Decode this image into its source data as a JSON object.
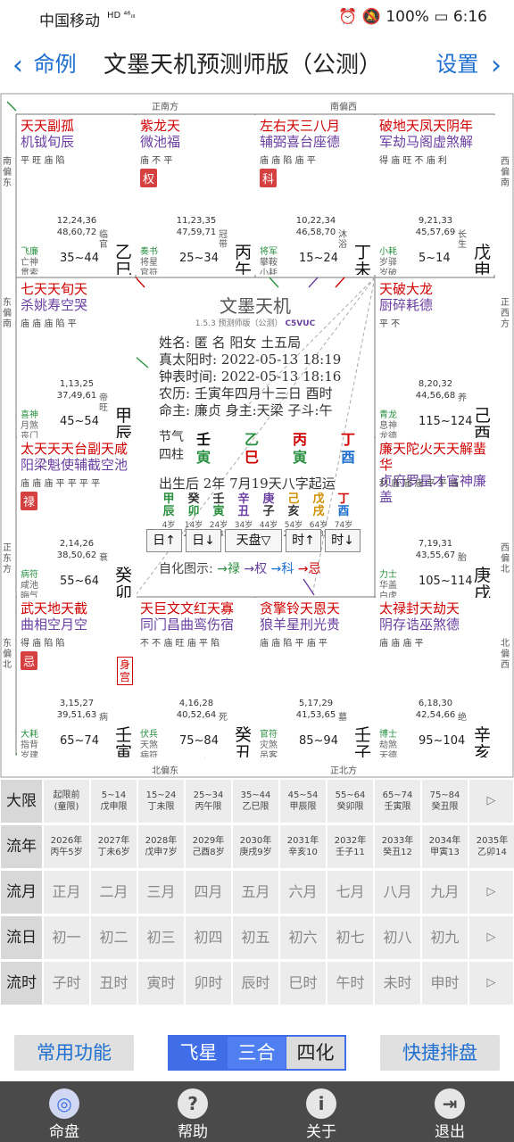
{
  "status": {
    "carrier": "中国移动",
    "network": "HD ⁴⁶ᵢₗₗ",
    "battery": "100%",
    "time": "6:16"
  },
  "nav": {
    "back": "命例",
    "title": "文墨天机预测师版（公测）",
    "settings": "设置"
  },
  "directions": {
    "top_left": "正南方",
    "top_right": "南偏西",
    "bottom_left": "北偏东",
    "bottom_right": "正北方",
    "left_1": "南偏东",
    "left_2": "东偏南",
    "left_3": "正东方",
    "left_4": "东偏北",
    "right_1": "西偏南",
    "right_2": "正西方",
    "right_3": "西偏北",
    "right_4": "北偏西"
  },
  "palaces": [
    {
      "stars_top": "天天副孤",
      "stars_top2": "机钺旬辰",
      "bright": "平 旺 庙 陷",
      "sihua": "",
      "ages1": "12,24,36",
      "ages2": "48,60,72",
      "dx": "35~44",
      "zs": "临官",
      "gz": "乙巳",
      "name": "子女",
      "god1": "飞廉",
      "god2": "亡神",
      "god3": "贯索"
    },
    {
      "stars_top": "紫龙天",
      "stars_top2": "微池福",
      "bright": "庙 不 平",
      "sihua": "权",
      "ages1": "11,23,35",
      "ages2": "47,59,71",
      "dx": "25~34",
      "zs": "冠带",
      "gz": "丙午",
      "name": "夫妻",
      "god1": "奏书",
      "god2": "将星",
      "god3": "官符"
    },
    {
      "stars_top": "左右天三八月",
      "stars_top2": "辅弼喜台座德",
      "bright": "庙 庙 陷 庙 平",
      "sihua": "科",
      "ages1": "10,22,34",
      "ages2": "46,58,70",
      "dx": "15~24",
      "zs": "沐浴",
      "gz": "丁未",
      "name": "兄弟",
      "god1": "将军",
      "god2": "攀鞍",
      "god3": "小耗"
    },
    {
      "stars_top": "破地天凤天阴年",
      "stars_top2": "军劫马阁虚煞解",
      "bright": "得 庙 旺 不 庙 利",
      "sihua": "",
      "ages1": "9,21,33",
      "ages2": "45,57,69",
      "dx": "5~14",
      "zs": "长生",
      "gz": "戊申",
      "name": "命宫",
      "god1": "小耗",
      "god2": "岁驿",
      "god3": "岁破"
    },
    {
      "stars_top": "七天天旬天",
      "stars_top2": "杀姚寿空哭",
      "bright": "庙 庙 庙 陷 平",
      "sihua": "",
      "ages1": "1,13,25",
      "ages2": "37,49,61",
      "dx": "45~54",
      "zs": "帝旺",
      "gz": "甲辰",
      "name": "财帛",
      "god1": "喜神",
      "god2": "月煞",
      "god3": "丧门"
    },
    {
      "stars_top": "天破大龙",
      "stars_top2": "厨碎耗德",
      "bright": "平 不",
      "sihua": "",
      "ages1": "8,20,32",
      "ages2": "44,56,68",
      "dx": "115~124",
      "zs": "养",
      "gz": "己酉",
      "name": "父母",
      "god1": "青龙",
      "god2": "息神",
      "god3": "龙德"
    },
    {
      "stars_top": "太天天天台副天咸",
      "stars_top2": "阳梁魁使辅截空池",
      "bright": "庙 庙 庙 平   平 平 平",
      "sihua": "禄",
      "ages1": "2,14,26",
      "ages2": "38,50,62",
      "dx": "55~64",
      "zs": "衰",
      "gz": "癸卯",
      "name": "疾厄",
      "god1": "病符",
      "god2": "咸池",
      "god3": "晦气"
    },
    {
      "stars_top": "廉天陀火天天解蜚华",
      "stars_top2": "贞府罗星才官神廉盖",
      "bright": "利 庙 庙 庙 平 平   庙",
      "sihua": "",
      "ages1": "7,19,31",
      "ages2": "43,55,67",
      "dx": "105~114",
      "zs": "胎",
      "gz": "庚戌",
      "name": "福德",
      "god1": "力士",
      "god2": "华盖",
      "god3": "白虎"
    },
    {
      "stars_top": "武天地天截",
      "stars_top2": "曲相空月空",
      "bright": "得 庙 陷 陷",
      "sihua": "忌",
      "ages1": "3,15,27",
      "ages2": "39,51,63",
      "dx": "65~74",
      "zs": "病",
      "gz": "壬寅",
      "name": "迁移",
      "god1": "大耗",
      "god2": "指背",
      "god3": "岁建",
      "shen": "身宫"
    },
    {
      "stars_top": "天巨文文红天寡",
      "stars_top2": "同门昌曲鸾伤宿",
      "bright": "不 不 庙 旺 庙 平 陷",
      "sihua": "",
      "ages1": "4,16,28",
      "ages2": "40,52,64",
      "dx": "75~84",
      "zs": "死",
      "gz": "癸丑",
      "name": "交友",
      "god1": "伏兵",
      "god2": "天煞",
      "god3": "病符"
    },
    {
      "stars_top": "贪擎铃天恩天",
      "stars_top2": "狼羊星刑光贵",
      "bright": "庙 庙 陷 平 庙 平",
      "sihua": "",
      "ages1": "5,17,29",
      "ages2": "41,53,65",
      "dx": "85~94",
      "zs": "墓",
      "gz": "壬子",
      "name": "官禄",
      "god1": "官符",
      "god2": "灾煞",
      "god3": "吊客"
    },
    {
      "stars_top": "太禄封天劫天",
      "stars_top2": "阴存诰巫煞德",
      "bright": "庙 庙 庙 平",
      "sihua": "",
      "ages1": "6,18,30",
      "ages2": "42,54,66",
      "dx": "95~104",
      "zs": "绝",
      "gz": "辛亥",
      "name": "田宅",
      "god1": "博士",
      "god2": "劫煞",
      "god3": "天德"
    }
  ],
  "center": {
    "title": "文墨天机",
    "version": "1.5.3 预测师版（公测）",
    "code": "C5VUC",
    "name_line": "姓名: 匿 名      阳女 土五局",
    "solar_line": "真太阳时: 2022-05-13 18:19",
    "clock_line": "钟表时间: 2022-05-13 18:16",
    "lunar_line": "农历: 壬寅年四月十三日 酉时",
    "master_line": "命主: 廉贞 身主:天梁 子斗:午",
    "jieqi_label": "节气",
    "sizhu_label": "四柱",
    "jq": [
      "壬",
      "乙",
      "丙",
      "丁"
    ],
    "sz": [
      "寅",
      "巳",
      "寅",
      "酉"
    ],
    "trun_line": "出生后 2年 7月19天八字起运",
    "dayun": [
      {
        "g": "甲",
        "z": "辰",
        "a": "4岁",
        "y": "2025"
      },
      {
        "g": "癸",
        "z": "卯",
        "a": "14岁",
        "y": "2035"
      },
      {
        "g": "壬",
        "z": "寅",
        "a": "24岁",
        "y": "2045"
      },
      {
        "g": "辛",
        "z": "丑",
        "a": "34岁",
        "y": "2055"
      },
      {
        "g": "庚",
        "z": "子",
        "a": "44岁",
        "y": "2065"
      },
      {
        "g": "己",
        "z": "亥",
        "a": "54岁",
        "y": "2075"
      },
      {
        "g": "戊",
        "z": "戌",
        "a": "64岁",
        "y": "2085"
      },
      {
        "g": "丁",
        "z": "酉",
        "a": "74岁",
        "y": "2095"
      }
    ],
    "btn_day_up": "日↑",
    "btn_day_down": "日↓",
    "btn_pan": "天盘▽",
    "btn_hour_up": "时↑",
    "btn_hour_down": "时↓",
    "zihua_label": "自化图示:",
    "zihua_lu": "→禄",
    "zihua_quan": "→权",
    "zihua_ke": "→科",
    "zihua_ji": "→忌"
  },
  "rows": {
    "daxian": {
      "label": "大限",
      "cells": [
        [
          "起限前",
          "(童限)"
        ],
        [
          "5~14",
          "戊申限"
        ],
        [
          "15~24",
          "丁未限"
        ],
        [
          "25~34",
          "丙午限"
        ],
        [
          "35~44",
          "乙巳限"
        ],
        [
          "45~54",
          "甲辰限"
        ],
        [
          "55~64",
          "癸卯限"
        ],
        [
          "65~74",
          "壬寅限"
        ],
        [
          "75~84",
          "癸丑限"
        ]
      ],
      "arrow": "▷"
    },
    "liunian": {
      "label": "流年",
      "cells": [
        [
          "2026年",
          "丙午5岁"
        ],
        [
          "2027年",
          "丁未6岁"
        ],
        [
          "2028年",
          "戊申7岁"
        ],
        [
          "2029年",
          "己酉8岁"
        ],
        [
          "2030年",
          "庚戌9岁"
        ],
        [
          "2031年",
          "辛亥10"
        ],
        [
          "2032年",
          "壬子11"
        ],
        [
          "2033年",
          "癸丑12"
        ],
        [
          "2034年",
          "甲寅13"
        ],
        [
          "2035年",
          "乙卯14"
        ]
      ]
    },
    "liuyue": {
      "label": "流月",
      "cells": [
        "正月",
        "二月",
        "三月",
        "四月",
        "五月",
        "六月",
        "七月",
        "八月",
        "九月"
      ],
      "arrow": "▷"
    },
    "liuri": {
      "label": "流日",
      "cells": [
        "初一",
        "初二",
        "初三",
        "初四",
        "初五",
        "初六",
        "初七",
        "初八",
        "初九"
      ],
      "arrow": "▷"
    },
    "liushi": {
      "label": "流时",
      "cells": [
        "子时",
        "丑时",
        "寅时",
        "卯时",
        "辰时",
        "巳时",
        "午时",
        "未时",
        "申时"
      ],
      "arrow": "▷"
    }
  },
  "toolbar": {
    "common": "常用功能",
    "seg1": "飞星",
    "seg2": "三合",
    "seg3": "四化",
    "quick": "快捷排盘"
  },
  "tabs": [
    "命盘",
    "帮助",
    "关于",
    "退出"
  ],
  "colors": {
    "accent": "#1f6fd0",
    "red": "#d00000",
    "purple": "#6a3fa0",
    "green": "#2a9040",
    "tabbar": "#4a4a4a",
    "segment": "#3f6ee8"
  }
}
